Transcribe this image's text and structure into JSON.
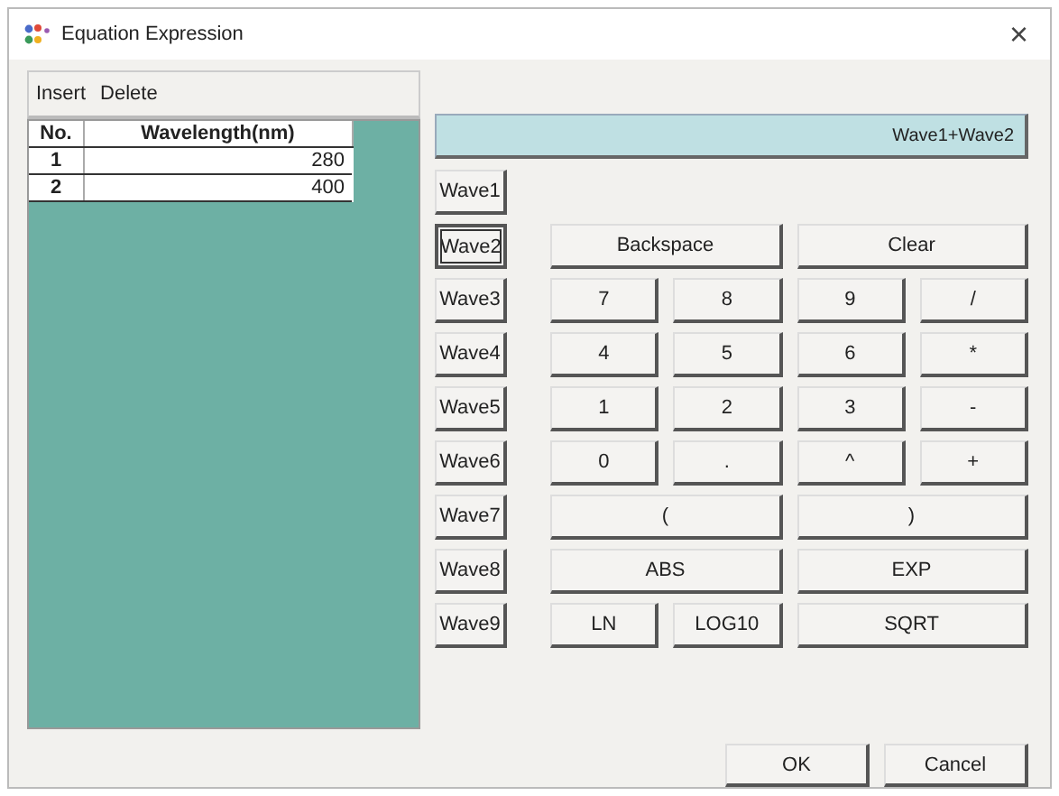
{
  "window": {
    "title": "Equation Expression",
    "close": "×"
  },
  "menu": [
    "Insert",
    "Delete"
  ],
  "table": {
    "columns": [
      "No.",
      "Wavelength(nm)"
    ],
    "rows": [
      {
        "cells": [
          "1",
          "280"
        ]
      },
      {
        "cells": [
          "2",
          "400"
        ]
      }
    ]
  },
  "expression": "Wave1+Wave2",
  "wave_buttons": [
    {
      "label": "Wave1",
      "focused": false
    },
    {
      "label": "Wave2",
      "focused": true
    },
    {
      "label": "Wave3",
      "focused": false
    },
    {
      "label": "Wave4",
      "focused": false
    },
    {
      "label": "Wave5",
      "focused": false
    },
    {
      "label": "Wave6",
      "focused": false
    },
    {
      "label": "Wave7",
      "focused": false
    },
    {
      "label": "Wave8",
      "focused": false
    },
    {
      "label": "Wave9",
      "focused": false
    }
  ],
  "keys": [
    {
      "label": "Backspace",
      "wide": true
    },
    {
      "label": "Clear",
      "wide": true
    },
    {
      "label": "7",
      "wide": false
    },
    {
      "label": "8",
      "wide": false
    },
    {
      "label": "9",
      "wide": false
    },
    {
      "label": "/",
      "wide": false
    },
    {
      "label": "4",
      "wide": false
    },
    {
      "label": "5",
      "wide": false
    },
    {
      "label": "6",
      "wide": false
    },
    {
      "label": "*",
      "wide": false
    },
    {
      "label": "1",
      "wide": false
    },
    {
      "label": "2",
      "wide": false
    },
    {
      "label": "3",
      "wide": false
    },
    {
      "label": "-",
      "wide": false
    },
    {
      "label": "0",
      "wide": false
    },
    {
      "label": ".",
      "wide": false
    },
    {
      "label": "^",
      "wide": false
    },
    {
      "label": "+",
      "wide": false
    },
    {
      "label": "(",
      "wide": true
    },
    {
      "label": ")",
      "wide": true
    },
    {
      "label": "ABS",
      "wide": true
    },
    {
      "label": "EXP",
      "wide": true
    },
    {
      "label": "LN",
      "wide": false
    },
    {
      "label": "LOG10",
      "wide": false
    },
    {
      "label": "SQRT",
      "wide": true
    }
  ],
  "buttons": [
    "OK",
    "Cancel"
  ]
}
